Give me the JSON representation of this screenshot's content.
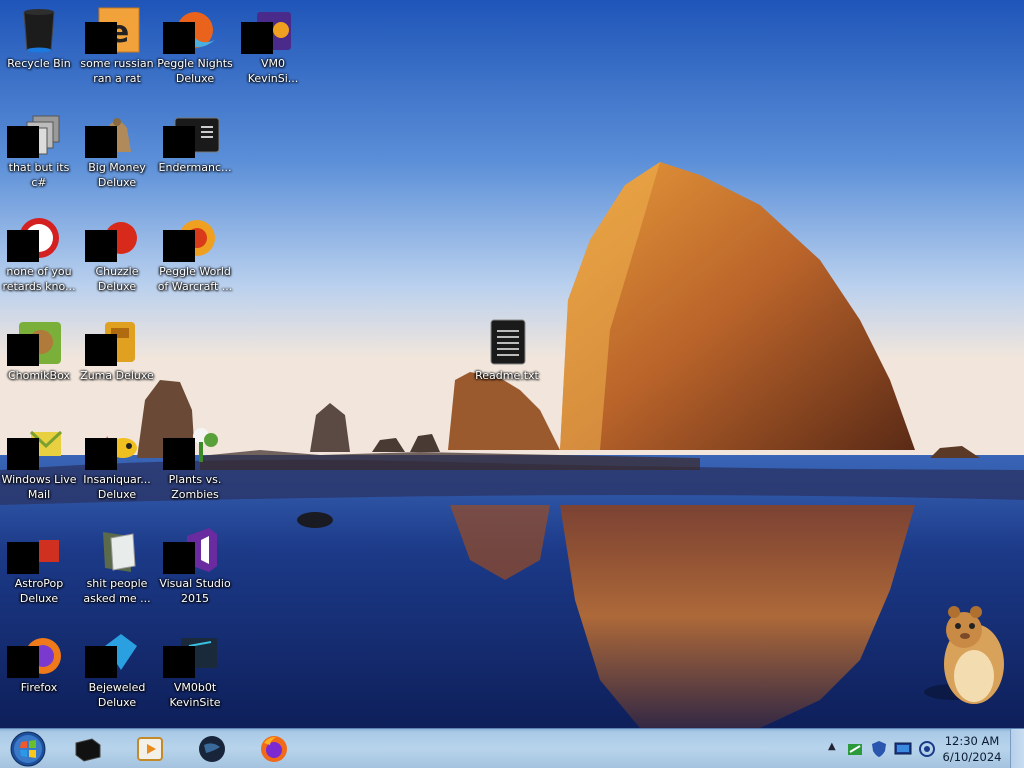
{
  "desktop": {
    "icons": [
      {
        "label": "Recycle Bin",
        "icon": "recycle-bin-icon"
      },
      {
        "label": "some russian ran a rat",
        "icon": "shortcut-icon"
      },
      {
        "label": "Peggle Nights Deluxe",
        "icon": "peggle-nights-icon"
      },
      {
        "label": "VM0 KevinSi...",
        "icon": "vm0-icon"
      },
      {
        "label": "that but its c#",
        "icon": "folder-stack-icon"
      },
      {
        "label": "Big Money Deluxe",
        "icon": "big-money-icon"
      },
      {
        "label": "Endermanc...",
        "icon": "terminal-icon"
      },
      {
        "label": "none of you retards kno...",
        "icon": "red-ball-icon"
      },
      {
        "label": "Chuzzle Deluxe",
        "icon": "chuzzle-icon"
      },
      {
        "label": "Peggle World of Warcraft ...",
        "icon": "peggle-wow-icon"
      },
      {
        "label": "ChomikBox",
        "icon": "chomikbox-icon"
      },
      {
        "label": "Zuma Deluxe",
        "icon": "zuma-icon"
      },
      {
        "label": "Readme.txt",
        "icon": "text-file-icon"
      },
      {
        "label": "Windows Live Mail",
        "icon": "mail-icon"
      },
      {
        "label": "Insaniquar... Deluxe",
        "icon": "insaniquarium-icon"
      },
      {
        "label": "Plants vs. Zombies",
        "icon": "plants-vs-zombies-icon"
      },
      {
        "label": "AstroPop Deluxe",
        "icon": "astropop-icon"
      },
      {
        "label": "shit people asked me ...",
        "icon": "folder-icon"
      },
      {
        "label": "Visual Studio 2015",
        "icon": "visual-studio-icon"
      },
      {
        "label": "Firefox",
        "icon": "firefox-icon"
      },
      {
        "label": "Bejeweled Deluxe",
        "icon": "bejeweled-icon"
      },
      {
        "label": "VM0b0t KevinSite",
        "icon": "vm0-icon"
      }
    ]
  },
  "taskbar": {
    "pinned": [
      {
        "name": "explorer",
        "icon": "black-box-icon"
      },
      {
        "name": "media-player",
        "icon": "media-player-icon"
      },
      {
        "name": "globe",
        "icon": "globe-icon"
      },
      {
        "name": "firefox",
        "icon": "firefox-icon"
      }
    ],
    "tray": {
      "chevron": "▲",
      "time": "12:30 AM",
      "date": "6/10/2024"
    }
  }
}
